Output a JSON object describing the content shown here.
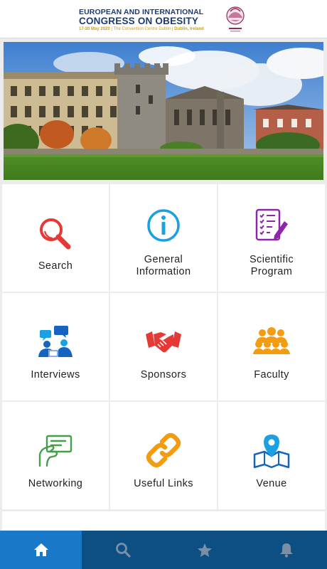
{
  "header": {
    "title_line1": "EUROPEAN AND INTERNATIONAL",
    "title_line2": "CONGRESS ON OBESITY",
    "dates": "17-20 May 2020",
    "venue": "| The Convention Centre Dublin |",
    "city": "Dublin, Ireland",
    "logo_icon": "eco-2020-logo"
  },
  "hero": {
    "image": "dublin-castle-photo"
  },
  "tiles": [
    {
      "label": "Search",
      "icon": "search-icon",
      "color": "#e53935"
    },
    {
      "label": "General\nInformation",
      "icon": "info-icon",
      "color": "#1ba1e2"
    },
    {
      "label": "Scientific\nProgram",
      "icon": "checklist-icon",
      "color": "#8e24aa"
    },
    {
      "label": "Interviews",
      "icon": "interview-icon",
      "color": "#1565c0"
    },
    {
      "label": "Sponsors",
      "icon": "handshake-icon",
      "color": "#e53935"
    },
    {
      "label": "Faculty",
      "icon": "group-icon",
      "color": "#f39c12"
    },
    {
      "label": "Networking",
      "icon": "business-card-icon",
      "color": "#43a047"
    },
    {
      "label": "Useful Links",
      "icon": "link-icon",
      "color": "#f39c12"
    },
    {
      "label": "Venue",
      "icon": "map-pin-icon",
      "color": "#1565c0"
    }
  ],
  "nav": {
    "items": [
      {
        "icon": "home-icon",
        "active": true
      },
      {
        "icon": "search-icon",
        "active": false
      },
      {
        "icon": "star-icon",
        "active": false
      },
      {
        "icon": "bell-icon",
        "active": false
      }
    ],
    "color": "#0d4f83",
    "active_color": "#1a78c9"
  }
}
